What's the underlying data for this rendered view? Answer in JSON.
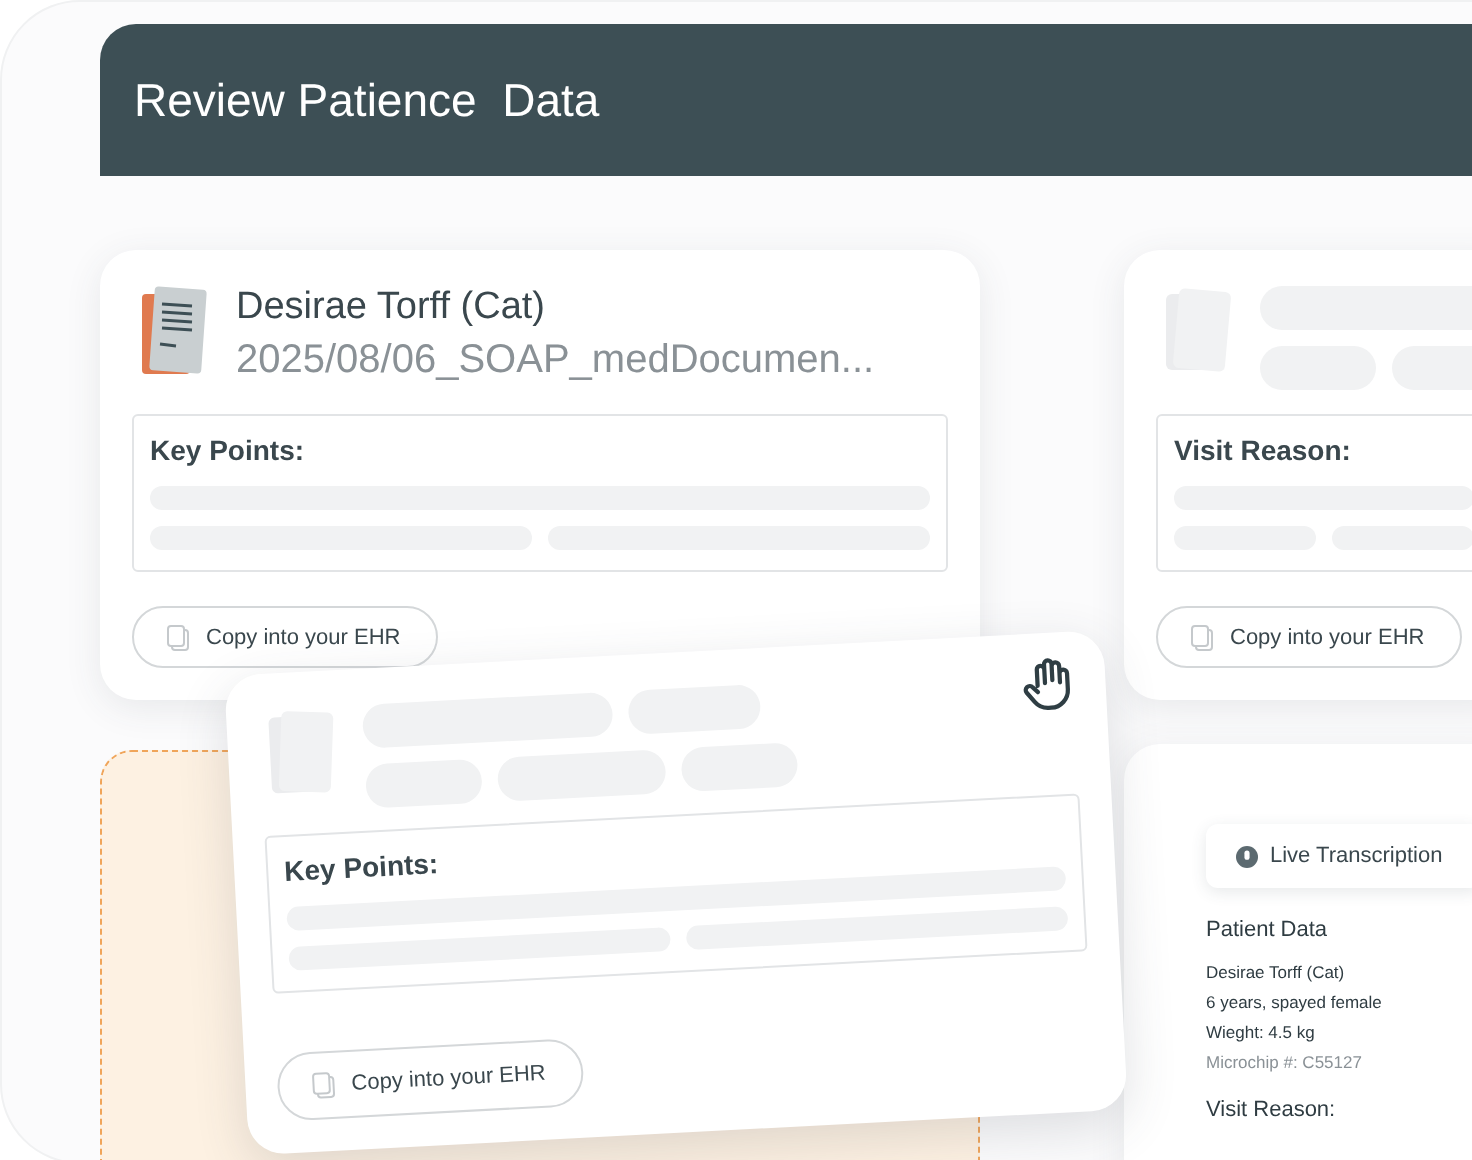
{
  "header": {
    "title": "Review Patience  Data"
  },
  "cards": [
    {
      "kind": "document",
      "name": "Desirae Torff (Cat)",
      "file": "2025/08/06_SOAP_medDocumen...",
      "section": "Key Points:",
      "button": "Copy into your EHR"
    },
    {
      "kind": "skeleton",
      "section": "Visit Reason:",
      "button": "Copy into your EHR"
    },
    {
      "kind": "skeleton",
      "section": "Key Points:",
      "button": "Copy into your EHR"
    }
  ],
  "panel": {
    "badge": "Live Transcription",
    "heading": "Patient Data",
    "lines": [
      {
        "text": "Desirae Torff (Cat)",
        "muted": false
      },
      {
        "text": "6 years, spayed female",
        "muted": false
      },
      {
        "text": "Wieght: 4.5 kg",
        "muted": false
      },
      {
        "text": "Microchip #: C55127",
        "muted": true
      }
    ],
    "subheading": "Visit Reason:"
  }
}
